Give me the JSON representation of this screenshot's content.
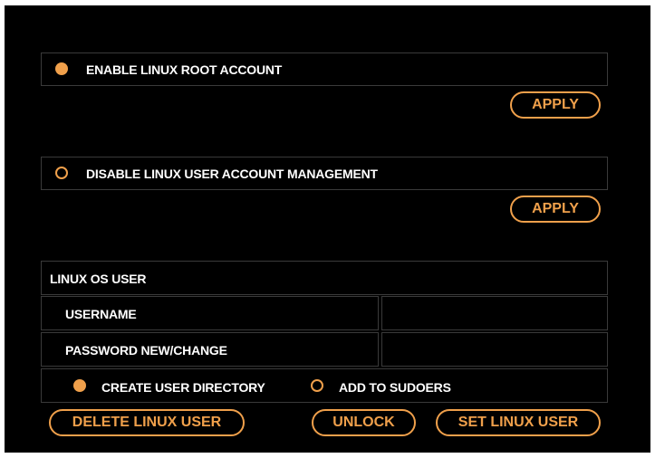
{
  "root_section": {
    "label": "ENABLE LINUX ROOT ACCOUNT",
    "selected": true,
    "apply_label": "APPLY"
  },
  "user_mgmt_section": {
    "label": "DISABLE LINUX USER ACCOUNT MANAGEMENT",
    "selected": false,
    "apply_label": "APPLY"
  },
  "os_user": {
    "title": "LINUX OS USER",
    "username_label": "USERNAME",
    "username_value": "",
    "password_label": "PASSWORD NEW/CHANGE",
    "password_value": "",
    "options": [
      {
        "label": "CREATE USER DIRECTORY",
        "selected": true
      },
      {
        "label": "ADD TO SUDOERS",
        "selected": false
      }
    ],
    "buttons": {
      "delete": "DELETE LINUX USER",
      "unlock": "UNLOCK",
      "set": "SET LINUX USER"
    }
  },
  "colors": {
    "accent": "#f0a04b",
    "background": "#000000",
    "border": "#3a3a3a",
    "text": "#ffffff"
  }
}
